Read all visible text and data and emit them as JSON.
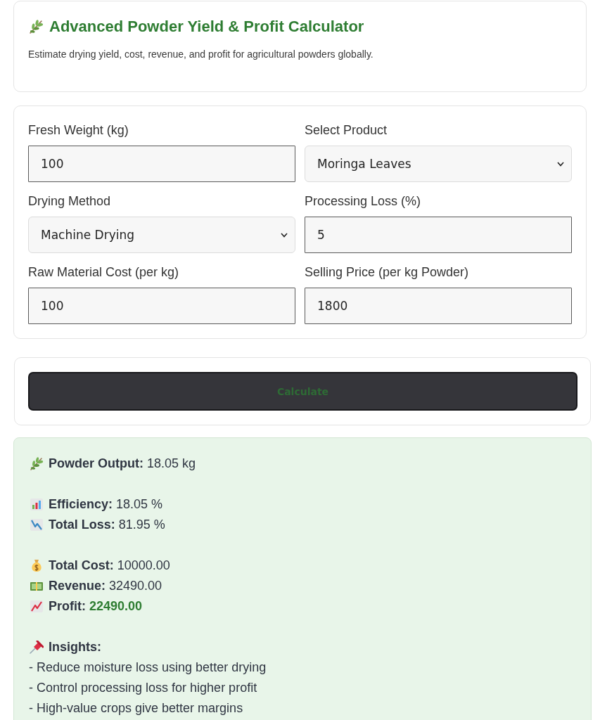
{
  "header": {
    "title": "Advanced Powder Yield & Profit Calculator",
    "subtitle": "Estimate drying yield, cost, revenue, and profit for agricultural powders globally."
  },
  "form": {
    "fields": [
      {
        "label": "Fresh Weight (kg)",
        "kind": "input",
        "value": "100"
      },
      {
        "label": "Select Product",
        "kind": "select",
        "value": "Moringa Leaves"
      },
      {
        "label": "Drying Method",
        "kind": "select",
        "value": "Machine Drying"
      },
      {
        "label": "Processing Loss (%)",
        "kind": "input",
        "value": "5"
      },
      {
        "label": "Raw Material Cost (per kg)",
        "kind": "input",
        "value": "100"
      },
      {
        "label": "Selling Price (per kg Powder)",
        "kind": "input",
        "value": "1800"
      }
    ]
  },
  "calculate_button": {
    "label": "Calculate"
  },
  "results": {
    "groups": [
      {
        "rows": [
          {
            "kind": "output",
            "label": "Powder Output:",
            "value": "18.05 kg",
            "highlighted": false
          }
        ]
      },
      {
        "rows": [
          {
            "kind": "efficiency",
            "label": "Efficiency:",
            "value": "18.05 %",
            "highlighted": false
          },
          {
            "kind": "loss",
            "label": "Total Loss:",
            "value": "81.95 %",
            "highlighted": false
          }
        ]
      },
      {
        "rows": [
          {
            "kind": "cost",
            "label": "Total Cost:",
            "value": "10000.00",
            "highlighted": false
          },
          {
            "kind": "revenue",
            "label": "Revenue:",
            "value": "32490.00",
            "highlighted": false
          },
          {
            "kind": "profit",
            "label": "Profit:",
            "value": "22490.00",
            "highlighted": true
          }
        ]
      }
    ],
    "insights": {
      "title": "Insights:",
      "items": [
        "- Reduce moisture loss using better drying",
        "- Control processing loss for higher profit",
        "- High-value crops give better margins"
      ]
    }
  }
}
